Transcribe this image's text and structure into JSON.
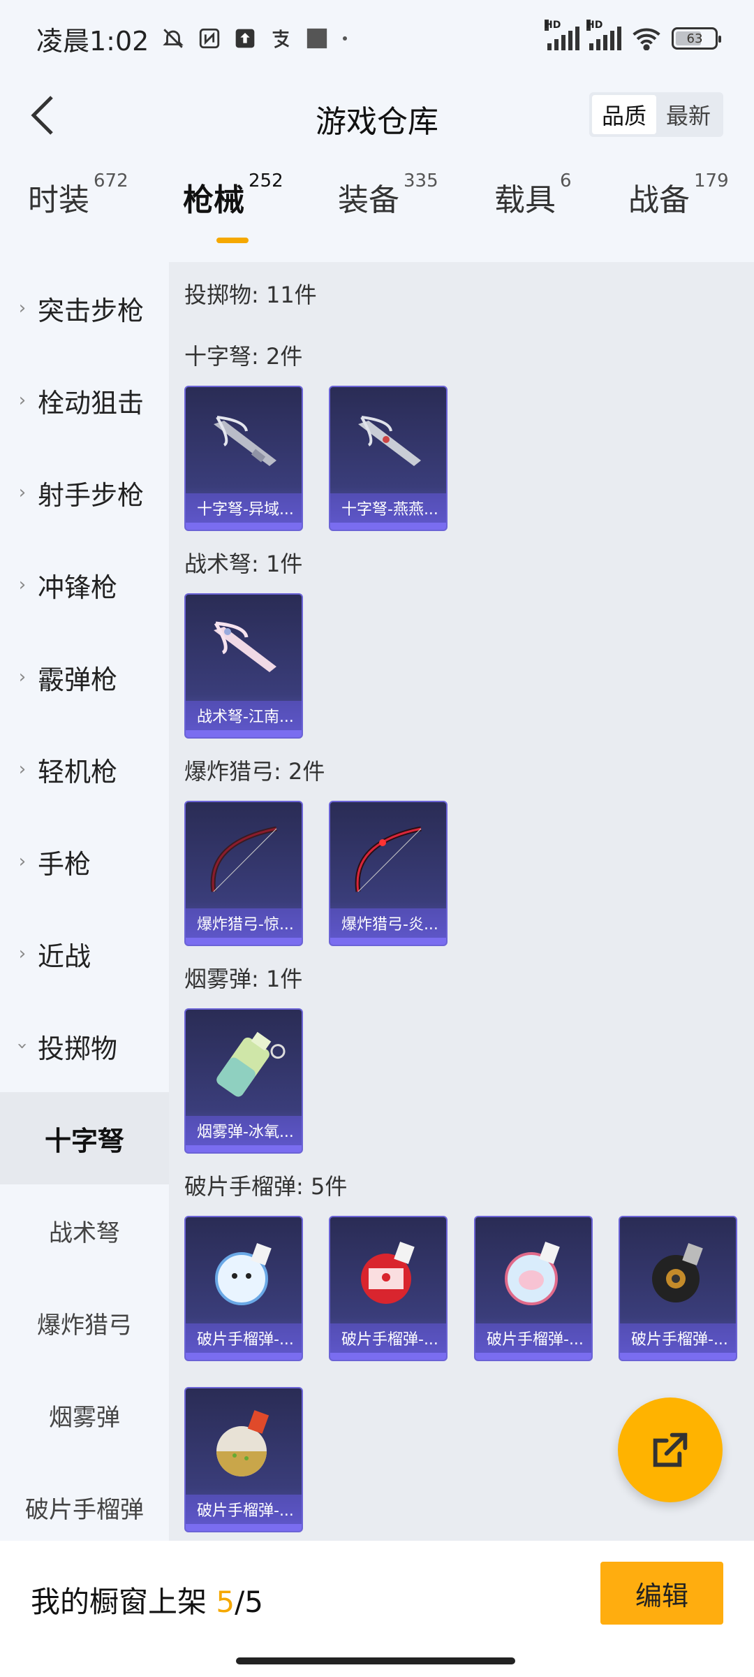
{
  "status_bar": {
    "time": "凌晨1:02",
    "battery": "63",
    "signal_label": "HD"
  },
  "header": {
    "title": "游戏仓库",
    "sort_options": [
      "品质",
      "最新"
    ],
    "sort_active": "品质"
  },
  "tabs": [
    {
      "label": "时装",
      "count": "672"
    },
    {
      "label": "枪械",
      "count": "252"
    },
    {
      "label": "装备",
      "count": "335"
    },
    {
      "label": "载具",
      "count": "6"
    },
    {
      "label": "战备",
      "count": "179"
    }
  ],
  "active_tab": "枪械",
  "sidebar": {
    "categories": [
      "突击步枪",
      "栓动狙击",
      "射手步枪",
      "冲锋枪",
      "霰弹枪",
      "轻机枪",
      "手枪",
      "近战",
      "投掷物"
    ],
    "expanded": "投掷物",
    "subcategories": [
      "十字弩",
      "战术弩",
      "爆炸猎弓",
      "烟雾弹",
      "破片手榴弹"
    ],
    "active_sub": "十字弩"
  },
  "content": {
    "header": "投掷物: 11件",
    "sections": [
      {
        "title": "十字弩: 2件",
        "items": [
          "十字弩-异域...",
          "十字弩-燕燕..."
        ],
        "art": "crossbow"
      },
      {
        "title": "战术弩: 1件",
        "items": [
          "战术弩-江南..."
        ],
        "art": "crossbow-pink"
      },
      {
        "title": "爆炸猎弓: 2件",
        "items": [
          "爆炸猎弓-惊...",
          "爆炸猎弓-炎..."
        ],
        "art": "bow"
      },
      {
        "title": "烟雾弹: 1件",
        "items": [
          "烟雾弹-冰氧..."
        ],
        "art": "smoke"
      },
      {
        "title": "破片手榴弹: 5件",
        "items": [
          "破片手榴弹-...",
          "破片手榴弹-...",
          "破片手榴弹-...",
          "破片手榴弹-...",
          "破片手榴弹-..."
        ],
        "art": "grenade"
      }
    ]
  },
  "bottom_bar": {
    "label": "我的橱窗上架",
    "current": "5",
    "total": "/5",
    "edit_label": "编辑"
  },
  "colors": {
    "accent": "#f5a800",
    "card_bg": "#3a3d7a",
    "card_border": "#6b63d6"
  }
}
